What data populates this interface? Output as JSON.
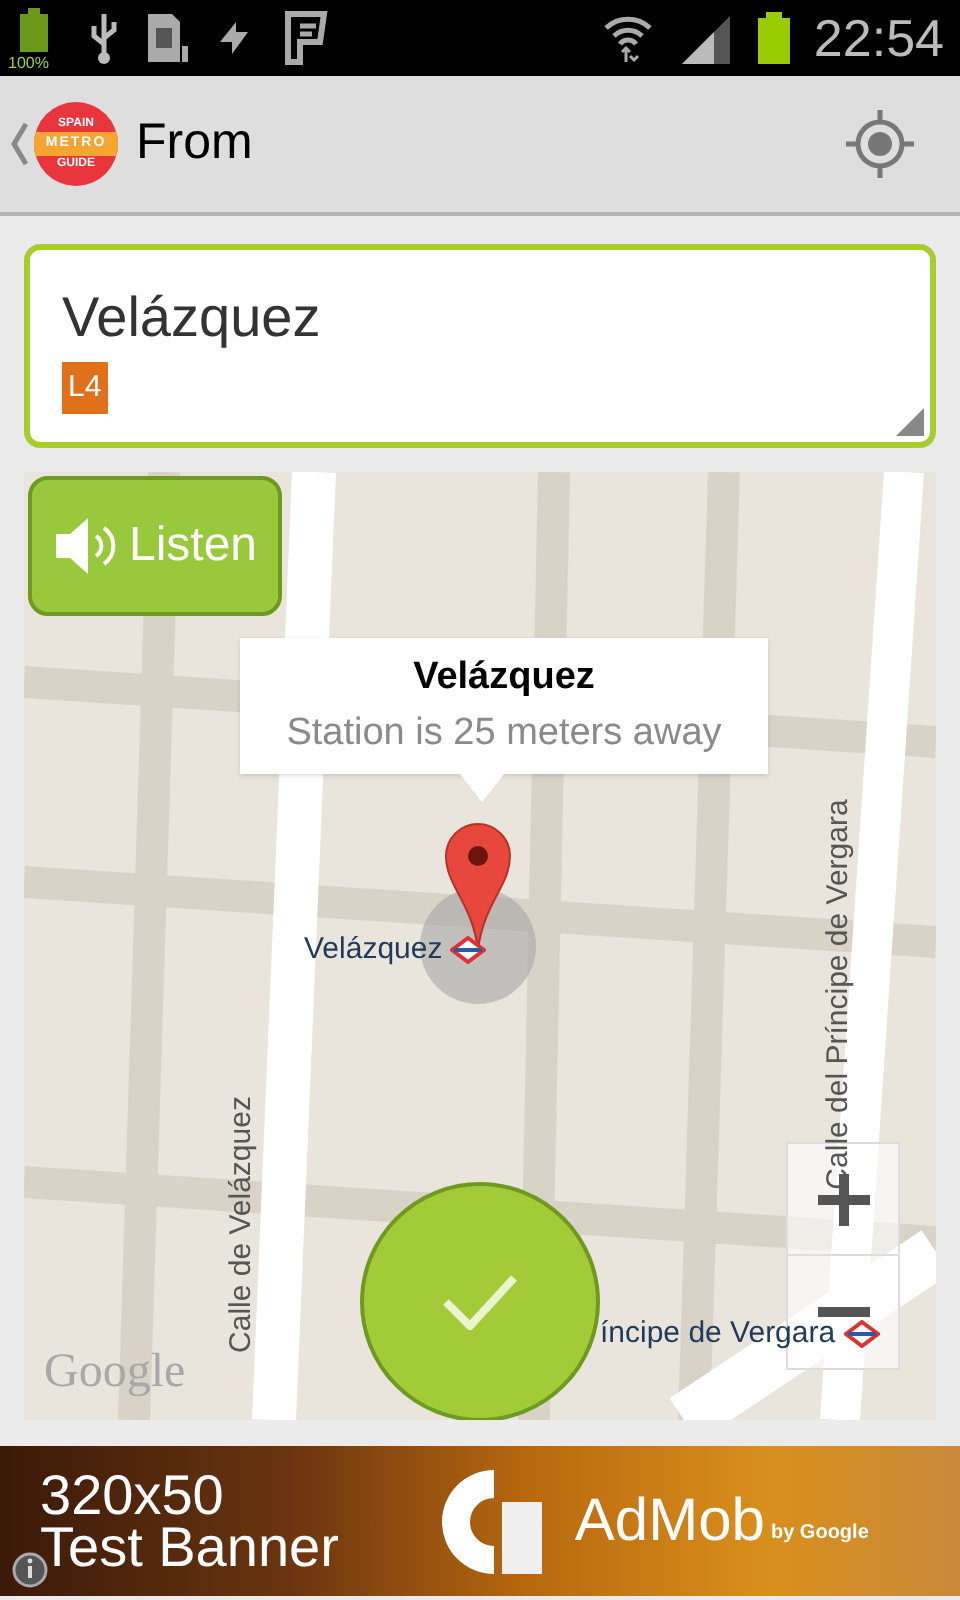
{
  "status_bar": {
    "battery_percent": "100%",
    "time": "22:54"
  },
  "app_bar": {
    "logo": {
      "top": "SPAIN",
      "middle": "METRO",
      "bottom": "GUIDE"
    },
    "title": "From"
  },
  "station_field": {
    "value": "Velázquez",
    "line_badge": {
      "label": "L4",
      "color": "#e0701c"
    }
  },
  "map": {
    "listen_button": "Listen",
    "callout": {
      "title": "Velázquez",
      "subtitle": "Station is 25 meters away"
    },
    "labels": [
      {
        "kind": "station",
        "text": "Velázquez"
      },
      {
        "kind": "street",
        "text": "Calle de Velázquez"
      },
      {
        "kind": "street",
        "text": "Calle del Príncipe de Vergara"
      },
      {
        "kind": "station",
        "text": "íncipe de Vergara"
      }
    ],
    "attribution": "Google"
  },
  "ad_banner": {
    "line_1": "320x50",
    "line_2": "Test Banner",
    "brand": "AdMob",
    "brand_suffix": "by Google"
  }
}
